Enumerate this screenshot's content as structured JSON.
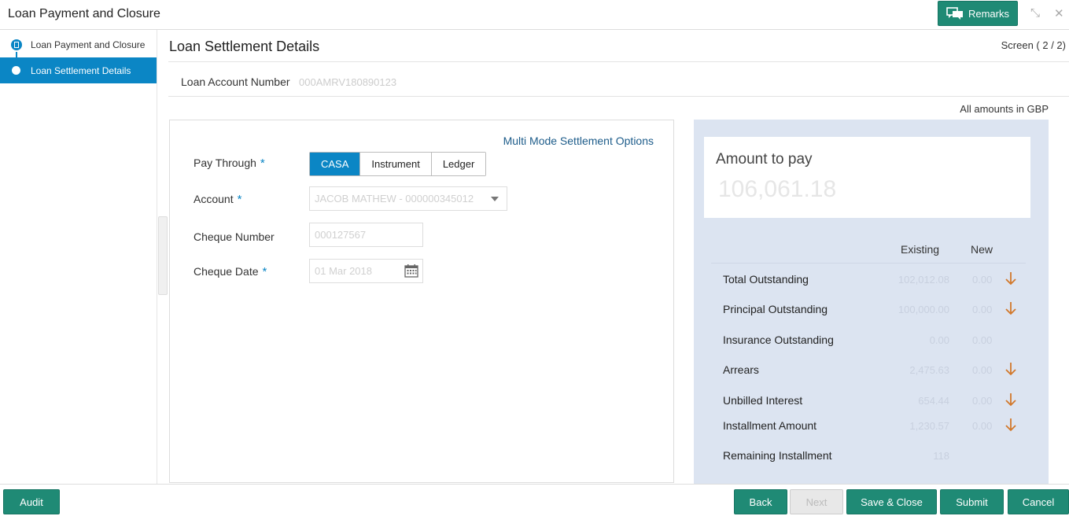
{
  "header": {
    "title": "Loan Payment and Closure",
    "remarks_label": "Remarks",
    "minimize_icon": "⤡",
    "close_icon": "✕"
  },
  "steps": [
    {
      "label": "Loan Payment and Closure"
    },
    {
      "label": "Loan Settlement Details"
    }
  ],
  "main": {
    "title": "Loan Settlement Details",
    "screen_counter": "Screen ( 2 / 2)",
    "account_number_label": "Loan Account Number",
    "account_number_value": "000AMRV180890123",
    "currency_note": "All amounts in GBP"
  },
  "form": {
    "multi_mode_link": "Multi Mode Settlement Options",
    "pay_through_label": "Pay Through",
    "required_marker": "*",
    "pay_options": [
      "CASA",
      "Instrument",
      "Ledger"
    ],
    "account_label": "Account",
    "account_value": "JACOB MATHEW - 000000345012",
    "cheque_number_label": "Cheque Number",
    "cheque_number_value": "000127567",
    "cheque_date_label": "Cheque Date",
    "cheque_date_value": "01 Mar 2018"
  },
  "summary": {
    "amount_label": "Amount to pay",
    "amount_value": "106,061.18",
    "existing_header": "Existing",
    "new_header": "New",
    "rows": [
      {
        "label": "Total Outstanding",
        "existing": "102,012.08",
        "new": "0.00"
      },
      {
        "label": "Principal Outstanding",
        "existing": "100,000.00",
        "new": "0.00"
      },
      {
        "label": "Insurance Outstanding",
        "existing": "0.00",
        "new": "0.00"
      },
      {
        "label": "Arrears",
        "existing": "2,475.63",
        "new": "0.00"
      },
      {
        "label": "Unbilled Interest",
        "existing": "654.44",
        "new": "0.00"
      },
      {
        "label": "Installment Amount",
        "existing": "1,230.57",
        "new": "0.00"
      },
      {
        "label": "Remaining Installment",
        "existing": "118",
        "new": ""
      }
    ]
  },
  "footer": {
    "audit": "Audit",
    "back": "Back",
    "next": "Next",
    "save_close": "Save & Close",
    "submit": "Submit",
    "cancel": "Cancel"
  },
  "colors": {
    "primary_green": "#1f8a75",
    "active_blue": "#0b86c5",
    "summary_bg": "#dce4f1",
    "arrow_orange": "#d2782a"
  }
}
